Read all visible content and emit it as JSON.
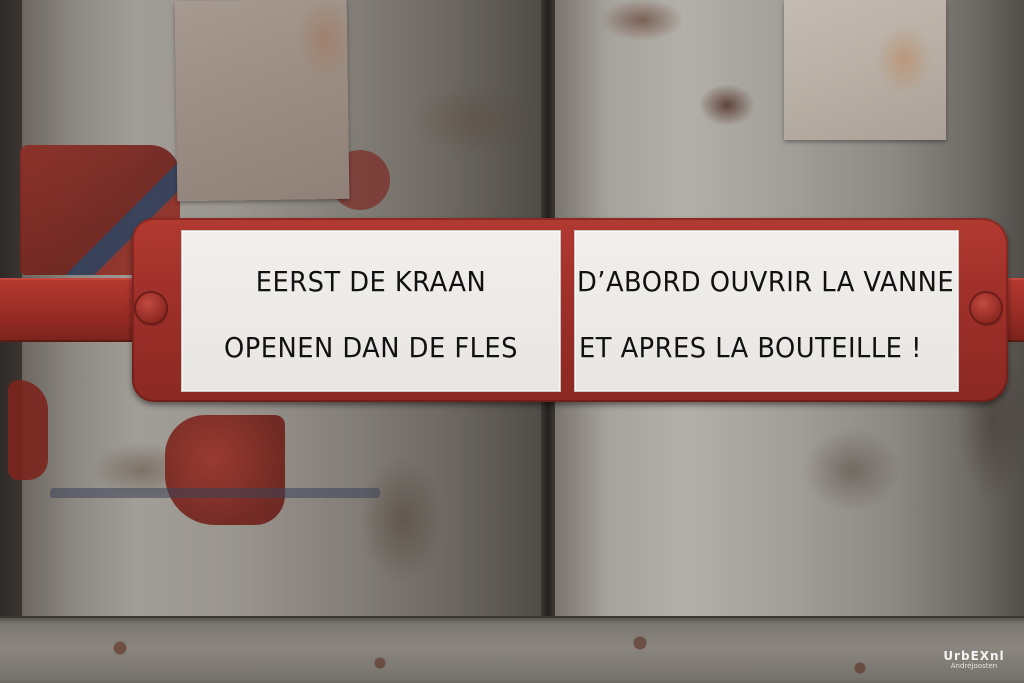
{
  "sign": {
    "dutch": {
      "line1": "EERST DE KRAAN",
      "line2": "OPENEN DAN DE FLES"
    },
    "french": {
      "line1": "D’ABORD OUVRIR LA VANNE",
      "line2": "ET APRES LA BOUTEILLE  !"
    }
  },
  "watermark": {
    "main": "UrbEXnl",
    "sub": "AndréJoosten"
  },
  "colors": {
    "bracket_red": "#a0302a",
    "plate_white": "#ecebe8",
    "text_black": "#111111",
    "cylinder_gray": "#9a958f"
  }
}
